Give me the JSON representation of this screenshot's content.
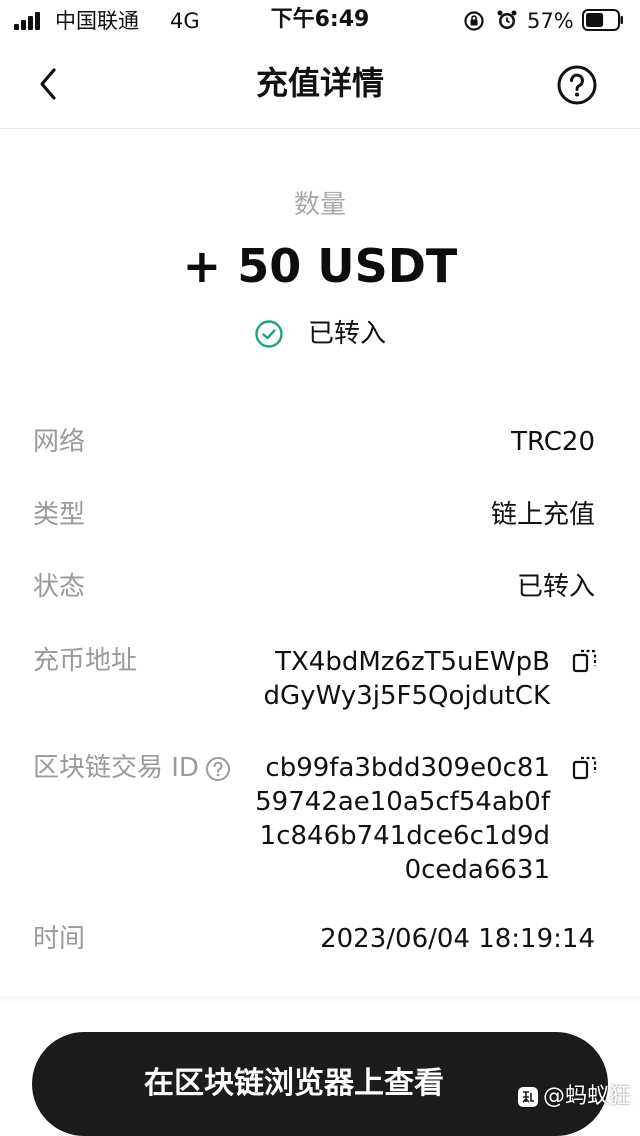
{
  "status_bar": {
    "carrier": "中国联通",
    "network_type": "4G",
    "time": "下午6:49",
    "battery_percent": "57%",
    "battery_level": 0.57,
    "icons": [
      "signal-icon",
      "rotation-lock-icon",
      "alarm-icon",
      "battery-icon"
    ]
  },
  "nav": {
    "title": "充值详情",
    "back_icon": "chevron-left-icon",
    "help_icon": "question-circle-icon"
  },
  "summary": {
    "amount_label": "数量",
    "amount": "+ 50 USDT",
    "status_icon": "check-circle-icon",
    "status_text": "已转入"
  },
  "details": {
    "network": {
      "label": "网络",
      "value": "TRC20"
    },
    "type": {
      "label": "类型",
      "value": "链上充值"
    },
    "status": {
      "label": "状态",
      "value": "已转入"
    },
    "address": {
      "label": "充币地址",
      "lines": [
        "TX4bdMz6zT5uEWpB",
        "dGyWy3j5F5QojdutCK"
      ]
    },
    "txid": {
      "label": "区块链交易 ID",
      "lines": [
        "cb99fa3bdd309e0c81",
        "59742ae10a5cf54ab0f",
        "1c846b741dce6c1d9d",
        "0ceda6631"
      ]
    },
    "time": {
      "label": "时间",
      "value": "2023/06/04 18:19:14"
    }
  },
  "action": {
    "explorer_button": "在区块链浏览器上查看"
  },
  "watermark": {
    "text": "@蚂蚁狂",
    "logo_icon": "zhihu-logo-icon"
  },
  "colors": {
    "accent_green": "#1aa67a",
    "label_gray": "#9a9a9a",
    "button_dark": "#1c1c1c"
  }
}
